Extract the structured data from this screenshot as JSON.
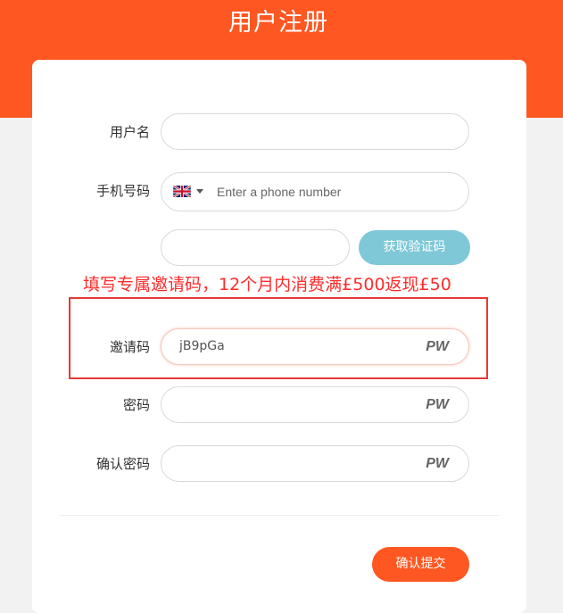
{
  "header": {
    "title": "用户注册"
  },
  "form": {
    "username": {
      "label": "用户名",
      "value": ""
    },
    "phone": {
      "label": "手机号码",
      "country": "United Kingdom",
      "flag_icon": "uk-flag-icon",
      "placeholder": "Enter a phone number"
    },
    "verification": {
      "value": "",
      "button_label": "获取验证码"
    },
    "promo_text": "填写专属邀请码，12个月内消费满£500返现£50",
    "invite_code": {
      "label": "邀请码",
      "value": "jB9pGa",
      "icon_text": "PW"
    },
    "password": {
      "label": "密码",
      "value": "",
      "icon_text": "PW"
    },
    "confirm_password": {
      "label": "确认密码",
      "value": "",
      "icon_text": "PW"
    },
    "submit_label": "确认提交"
  },
  "colors": {
    "brand": "#ff5722",
    "code_button": "#7ec8d8",
    "promo": "#ff2b2b",
    "highlight_border": "#e53935"
  }
}
